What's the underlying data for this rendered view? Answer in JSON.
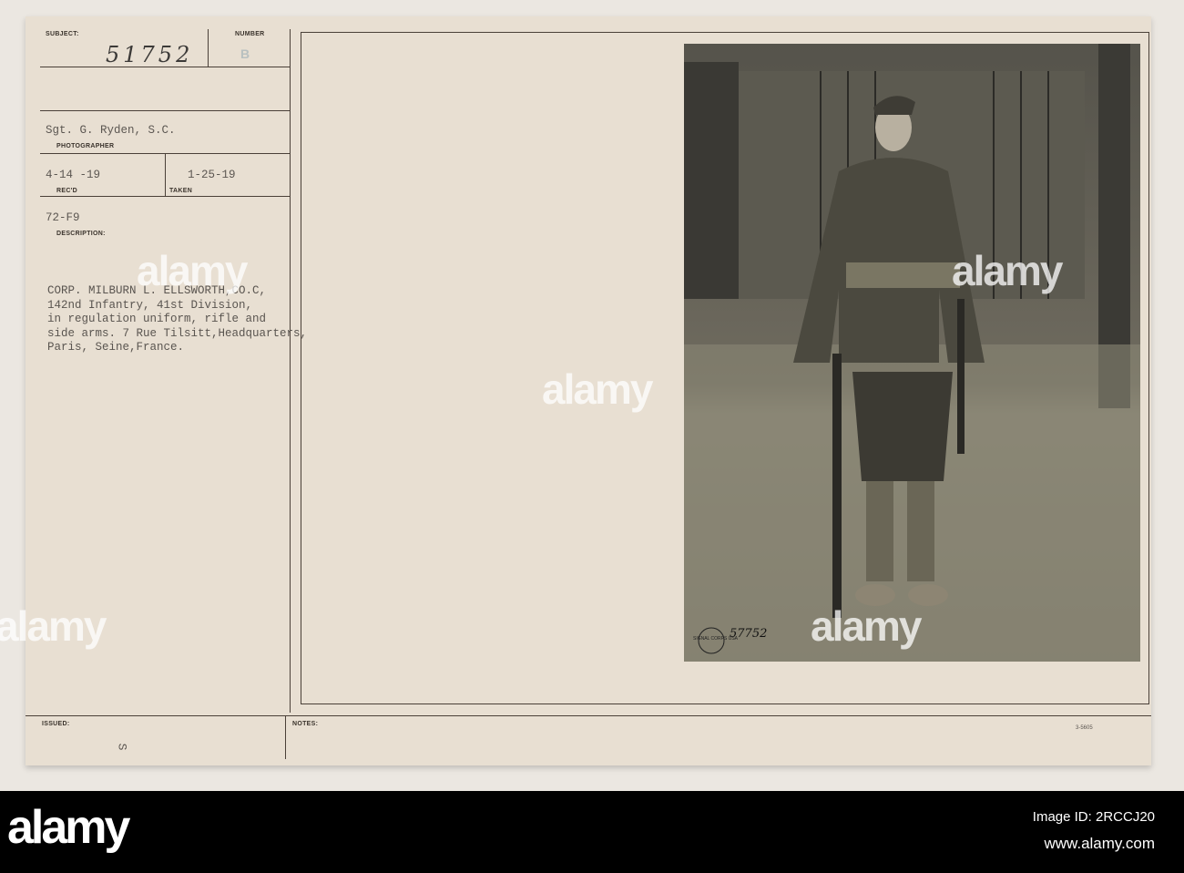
{
  "card": {
    "subject_label": "SUBJECT:",
    "subject_value": "51752",
    "number_label": "NUMBER",
    "number_value": "B",
    "photographer_value": "Sgt. G. Ryden, S.C.",
    "photographer_label": "PHOTOGRAPHER",
    "recd_value": "4-14 -19",
    "recd_label": "REC'D",
    "taken_value": "1-25-19",
    "taken_label": "TAKEN",
    "code_value": "72-F9",
    "description_label": "DESCRIPTION:",
    "description_lines": [
      "CORP. MILBURN L. ELLSWORTH,CO.C,",
      "142nd Infantry, 41st Division,",
      "in regulation uniform, rifle and",
      "side arms. 7 Rue Tilsitt,Headquarters,",
      "Paris, Seine,France."
    ],
    "issued_label": "ISSUED:",
    "issued_mark": "S",
    "notes_label": "NOTES:",
    "form_number": "3-5605"
  },
  "photo": {
    "stamp_text": "SIGNAL CORPS USA",
    "photo_number": "57752"
  },
  "watermark": "alamy",
  "footer": {
    "logo": "alamy",
    "image_id": "Image ID: 2RCCJ20",
    "url": "www.alamy.com"
  }
}
